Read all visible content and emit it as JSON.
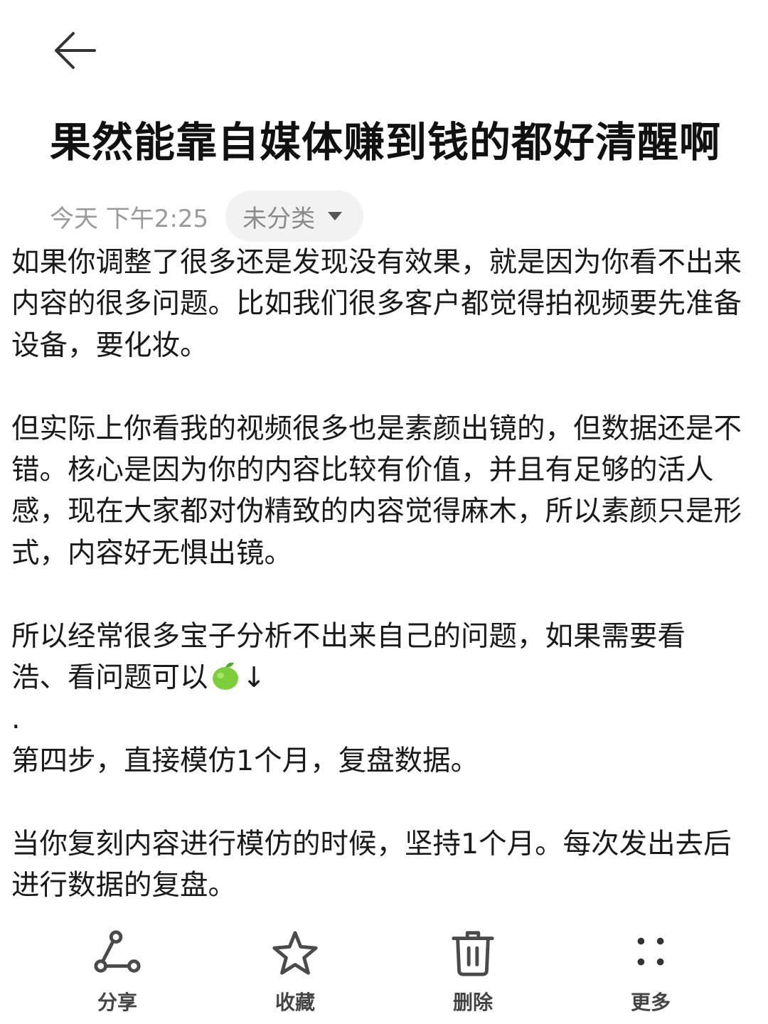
{
  "header": {
    "back_icon": "arrow-left-icon"
  },
  "note": {
    "title": "果然能靠自媒体赚到钱的都好清醒啊",
    "time": "今天 下午2:25",
    "category": "未分类",
    "category_icon": "caret-down-icon",
    "paragraphs": [
      "如果你调整了很多还是发现没有效果，就是因为你看不出来内容的很多问题。比如我们很多客户都觉得拍视频要先准备设备，要化妆。",
      "但实际上你看我的视频很多也是素颜出镜的，但数据还是不错。核心是因为你的内容比较有价值，并且有足够的活人感，现在大家都对伪精致的内容觉得麻木，所以素颜只是形式，内容好无惧出镜。",
      "所以经常很多宝子分析不出来自己的问题，如果需要看",
      "浩、看问题可以",
      "↓",
      ".",
      "第四步，直接模仿1个月，复盘数据。",
      "当你复刻内容进行模仿的时候，坚持1个月。每次发出去后进行数据的复盘。"
    ],
    "emoji_icon": "green-apple-icon"
  },
  "toolbar": {
    "items": [
      {
        "label": "分享",
        "icon": "share-icon"
      },
      {
        "label": "收藏",
        "icon": "star-icon"
      },
      {
        "label": "删除",
        "icon": "trash-icon"
      },
      {
        "label": "更多",
        "icon": "more-dots-icon"
      }
    ]
  },
  "colors": {
    "text": "#1a1a1a",
    "meta": "#9a9a9a",
    "chip_bg": "#f2f2f2",
    "toolbar_icon": "#4a4a4a",
    "apple": "#7ccf3a"
  }
}
